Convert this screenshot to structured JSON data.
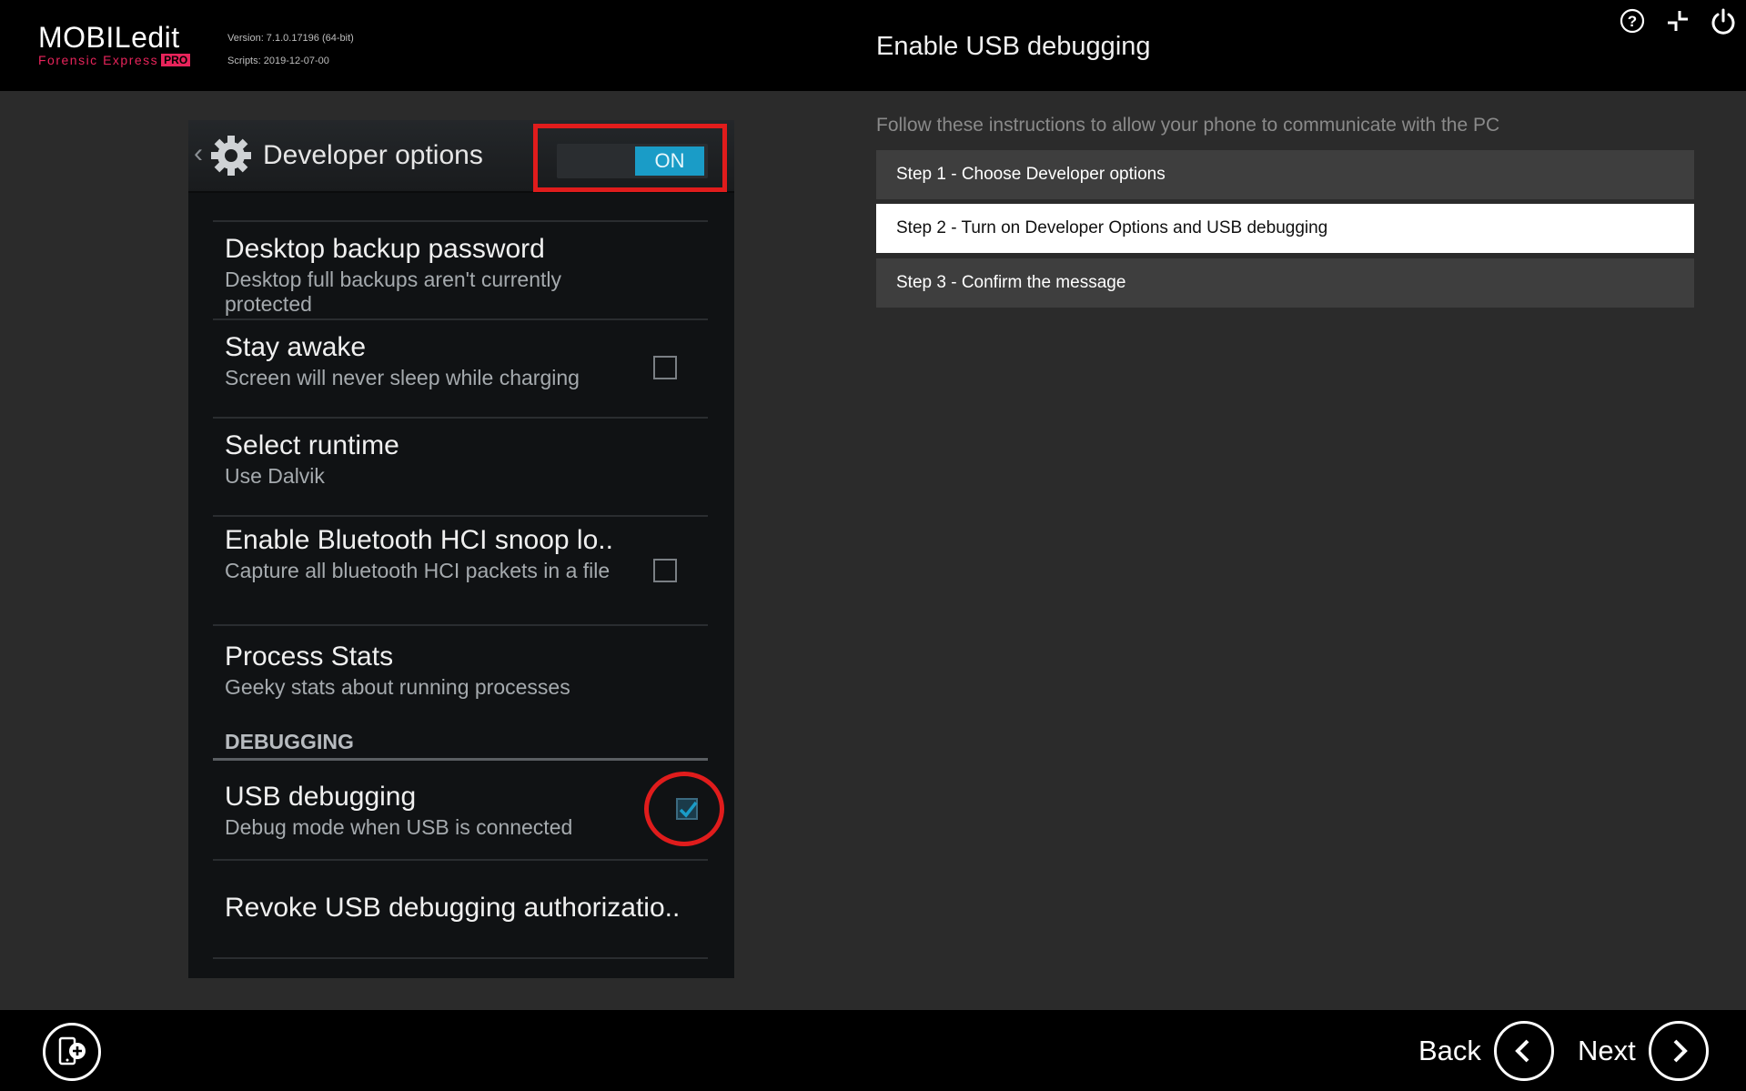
{
  "header": {
    "logo_main": "MOBILedit",
    "logo_sub": "Forensic Express",
    "logo_badge": "PRO",
    "version": "Version: 7.1.0.17196 (64-bit)",
    "scripts": "Scripts: 2019-12-07-00",
    "title": "Enable USB debugging",
    "icons": [
      "help-icon",
      "collapse-icon",
      "power-icon"
    ]
  },
  "phone": {
    "title": "Developer options",
    "toggle_label": "ON",
    "items": [
      {
        "title": "Desktop backup password",
        "subtitle": "Desktop full backups aren't currently protected"
      },
      {
        "title": "Stay awake",
        "subtitle": "Screen will never sleep while charging",
        "checked": false
      },
      {
        "title": "Select runtime",
        "subtitle": "Use Dalvik"
      },
      {
        "title": "Enable Bluetooth HCI snoop lo..",
        "subtitle": "Capture all bluetooth HCI packets in a file",
        "checked": false
      },
      {
        "title": "Process Stats",
        "subtitle": "Geeky stats about running processes"
      }
    ],
    "section": "DEBUGGING",
    "usb": {
      "title": "USB debugging",
      "subtitle": "Debug mode when USB is connected",
      "checked": true
    },
    "revoke": "Revoke USB debugging authorizatio.."
  },
  "instructions": "Follow these instructions to allow your phone to communicate with the PC",
  "steps": [
    {
      "label": "Step 1 - Choose Developer options",
      "active": false
    },
    {
      "label": "Step 2 - Turn on Developer Options and USB debugging",
      "active": true
    },
    {
      "label": "Step 3 - Confirm the message",
      "active": false
    }
  ],
  "footer": {
    "back": "Back",
    "next": "Next"
  },
  "colors": {
    "accent_red": "#e01c1c",
    "toggle_blue": "#1a9cc7",
    "brand_pink": "#e8245b"
  }
}
